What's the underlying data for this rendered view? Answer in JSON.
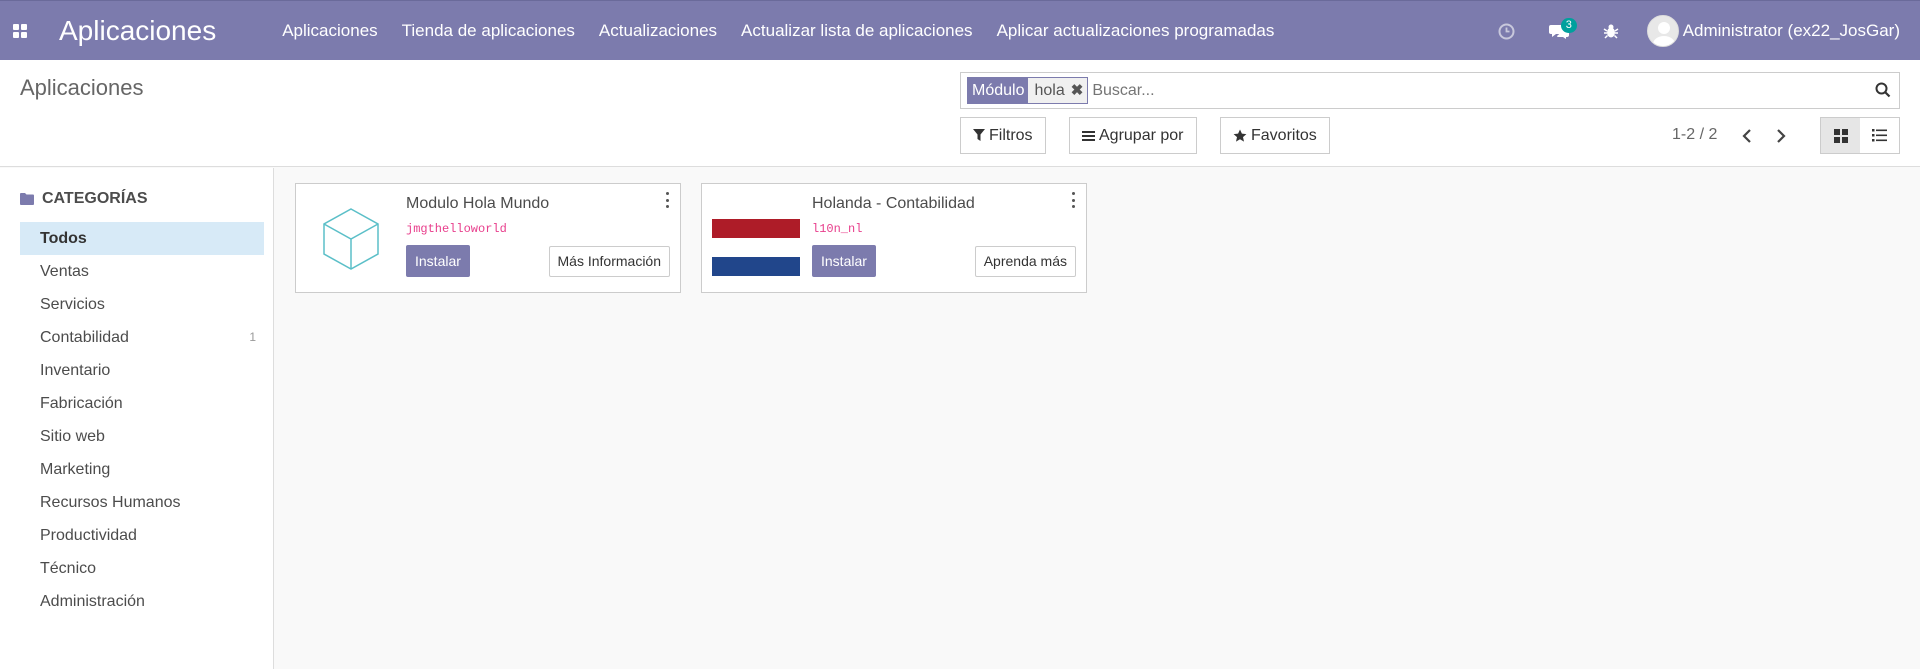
{
  "navbar": {
    "brand": "Aplicaciones",
    "menu": [
      "Aplicaciones",
      "Tienda de aplicaciones",
      "Actualizaciones",
      "Actualizar lista de aplicaciones",
      "Aplicar actualizaciones programadas"
    ],
    "chat_badge": "3",
    "user_name": "Administrator (ex22_JosGar)",
    "icons": [
      "apps-icon",
      "clock-icon",
      "chat-icon",
      "bug-icon"
    ]
  },
  "control_panel": {
    "breadcrumb": "Aplicaciones",
    "search": {
      "facet_label": "Módulo",
      "facet_value": "hola",
      "placeholder": "Buscar..."
    },
    "buttons": {
      "filters": "Filtros",
      "group_by": "Agrupar por",
      "favorites": "Favoritos"
    },
    "pager": "1-2 / 2"
  },
  "sidebar": {
    "header": "CATEGORÍAS",
    "items": [
      {
        "label": "Todos",
        "count": ""
      },
      {
        "label": "Ventas",
        "count": ""
      },
      {
        "label": "Servicios",
        "count": ""
      },
      {
        "label": "Contabilidad",
        "count": "1"
      },
      {
        "label": "Inventario",
        "count": ""
      },
      {
        "label": "Fabricación",
        "count": ""
      },
      {
        "label": "Sitio web",
        "count": ""
      },
      {
        "label": "Marketing",
        "count": ""
      },
      {
        "label": "Recursos Humanos",
        "count": ""
      },
      {
        "label": "Productividad",
        "count": ""
      },
      {
        "label": "Técnico",
        "count": ""
      },
      {
        "label": "Administración",
        "count": ""
      }
    ]
  },
  "cards": [
    {
      "title": "Modulo Hola Mundo",
      "technical_name": "jmgthelloworld",
      "install_label": "Instalar",
      "more_label": "Más Información",
      "icon": "cube-icon"
    },
    {
      "title": "Holanda - Contabilidad",
      "technical_name": "l10n_nl",
      "install_label": "Instalar",
      "more_label": "Aprenda más",
      "icon": "netherlands-flag-icon"
    }
  ],
  "colors": {
    "brand": "#7c7bad",
    "active_category": "#d7eaf7",
    "badge": "#00a09d",
    "tech_name": "#e83e8c",
    "flag_red": "#ae1c28",
    "flag_blue": "#21468b"
  }
}
